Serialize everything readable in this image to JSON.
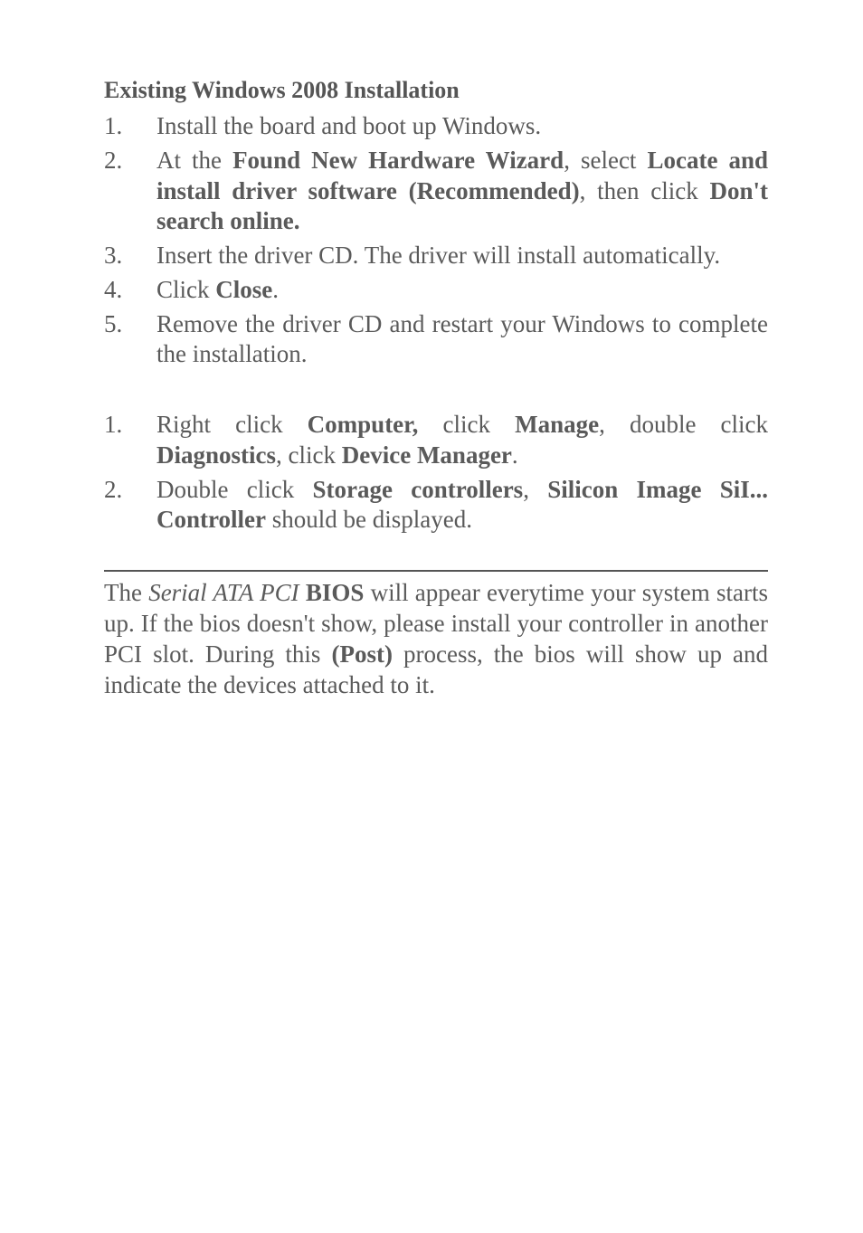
{
  "heading1": "Existing Windows 2008 Installation",
  "list1": {
    "item1": {
      "num": "1.",
      "text": "Install the board and boot up Windows."
    },
    "item2": {
      "num": "2.",
      "p1": "At the ",
      "b1": "Found New Hardware Wizard",
      "p2": ", select ",
      "b2": "Locate and install driver software (Recommended)",
      "p3": ", then click ",
      "b3": "Don't search online."
    },
    "item3": {
      "num": "3.",
      "text": "Insert the driver CD.  The driver will install automatically."
    },
    "item4": {
      "num": "4.",
      "p1": "Click ",
      "b1": "Close",
      "p2": "."
    },
    "item5": {
      "num": "5.",
      "text": "Remove the driver CD and restart your Windows to complete the installation."
    }
  },
  "list2": {
    "item1": {
      "num": "1.",
      "p1": "Right click ",
      "b1": "Computer,",
      "p2": " click ",
      "b2": "Manage",
      "p3": ", double click ",
      "b3": "Diagnostics",
      "p4": ", click ",
      "b4": "Device Manager",
      "p5": "."
    },
    "item2": {
      "num": "2.",
      "p1": "Double click ",
      "b1": "Storage controllers",
      "p2": ", ",
      "b2": "Silicon Image SiI... Controller",
      "p3": " should be displayed."
    }
  },
  "para": {
    "p1": "The ",
    "i1": "Serial ATA PCI",
    "p2": " ",
    "b1": "BIOS",
    "p3": " will appear everytime your system starts up.  If the bios doesn't show, please install your controller in another PCI slot.  During this ",
    "b2": "(Post)",
    "p4": " process, the bios will show up and indicate the devices attached to it."
  }
}
